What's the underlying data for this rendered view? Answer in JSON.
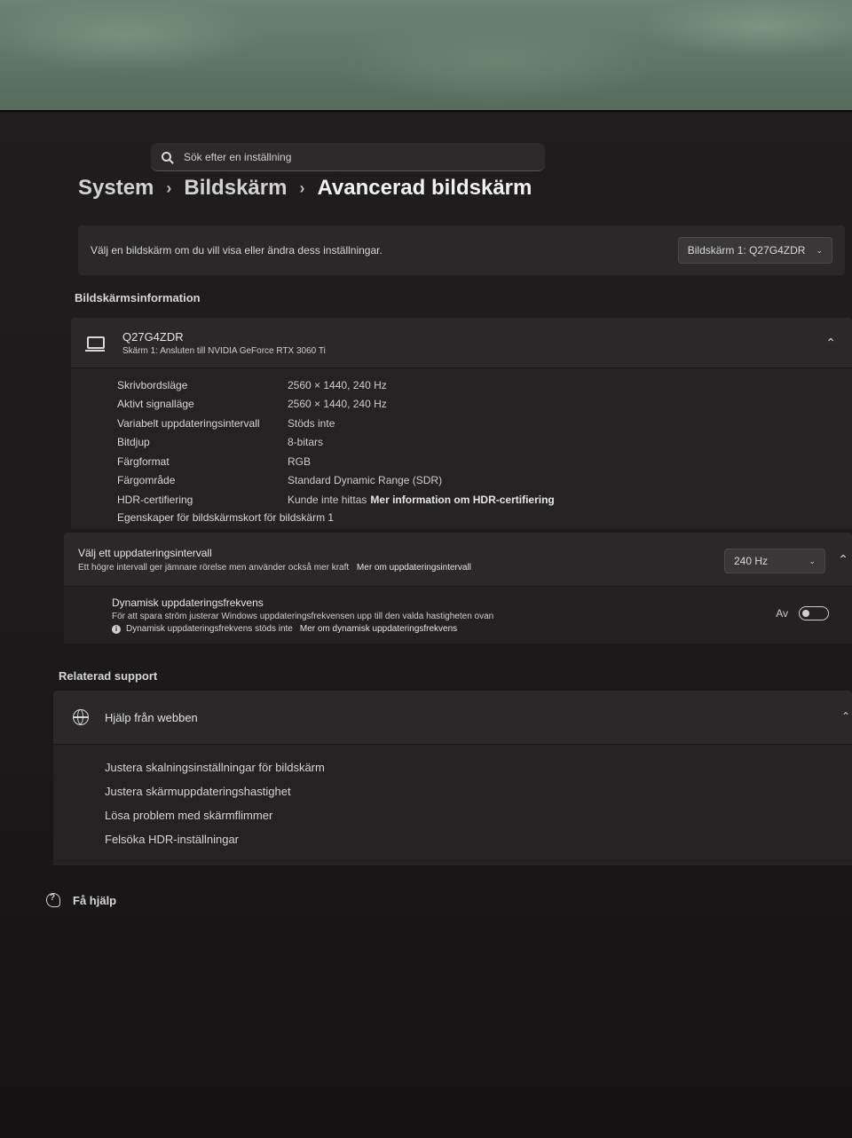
{
  "search": {
    "placeholder": "Sök efter en inställning"
  },
  "breadcrumb": {
    "level1": "System",
    "level2": "Bildskärm",
    "level3": "Avancerad bildskärm",
    "separator": "›"
  },
  "display_select": {
    "prompt": "Välj en bildskärm om du vill visa eller ändra dess inställningar.",
    "selected": "Bildskärm 1: Q27G4ZDR"
  },
  "display_info": {
    "heading": "Bildskärmsinformation",
    "monitor_name": "Q27G4ZDR",
    "monitor_sub": "Skärm 1: Ansluten till NVIDIA GeForce RTX 3060 Ti",
    "rows": [
      {
        "label": "Skrivbordsläge",
        "value": "2560 × 1440, 240 Hz"
      },
      {
        "label": "Aktivt signalläge",
        "value": "2560 × 1440, 240 Hz"
      },
      {
        "label": "Variabelt uppdateringsintervall",
        "value": "Stöds inte"
      },
      {
        "label": "Bitdjup",
        "value": "8-bitars"
      },
      {
        "label": "Färgformat",
        "value": "RGB"
      },
      {
        "label": "Färgområde",
        "value": "Standard Dynamic Range (SDR)"
      },
      {
        "label": "HDR-certifiering",
        "value": "Kunde inte hittas",
        "link": "Mer information om HDR-certifiering"
      }
    ],
    "adapter_link": "Egenskaper för bildskärmskort för bildskärm 1"
  },
  "refresh": {
    "title": "Välj ett uppdateringsintervall",
    "subtitle": "Ett högre intervall ger jämnare rörelse men använder också mer kraft",
    "link": "Mer om uppdateringsintervall",
    "selected": "240 Hz"
  },
  "dynamic": {
    "title": "Dynamisk uppdateringsfrekvens",
    "subtitle": "För att spara ström justerar Windows uppdateringsfrekvensen upp till den valda hastigheten ovan",
    "note": "Dynamisk uppdateringsfrekvens stöds inte",
    "note_link": "Mer om dynamisk uppdateringsfrekvens",
    "toggle_label": "Av"
  },
  "support": {
    "heading": "Relaterad support",
    "title": "Hjälp från webben",
    "links": [
      "Justera skalningsinställningar för bildskärm",
      "Justera skärmuppdateringshastighet",
      "Lösa problem med skärmflimmer",
      "Felsöka HDR-inställningar"
    ]
  },
  "get_help": {
    "label": "Få hjälp"
  }
}
